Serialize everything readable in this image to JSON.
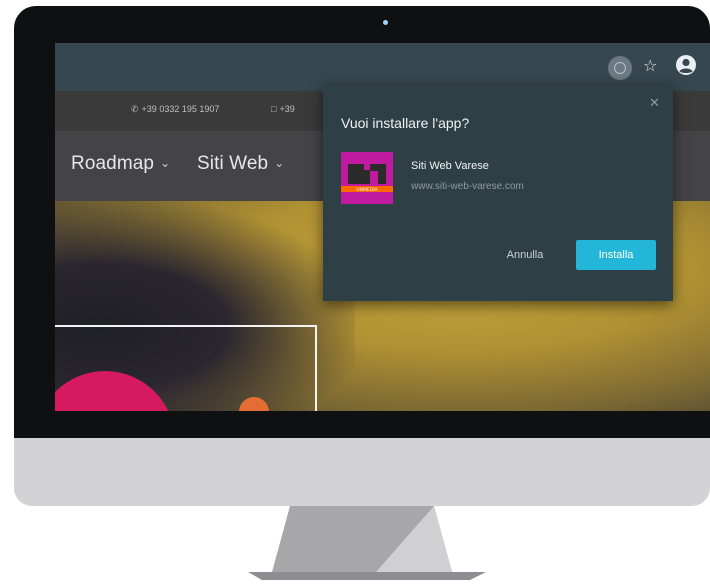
{
  "browser": {
    "icons": [
      "install-icon",
      "star-icon",
      "profile-icon"
    ]
  },
  "site": {
    "contacts": [
      {
        "icon": "phone-icon",
        "text": "+39 0332 195 1907"
      },
      {
        "icon": "phone-icon",
        "text": "+39"
      }
    ],
    "nav": [
      {
        "label": "Roadmap",
        "icon": "chevron-down-icon"
      },
      {
        "label": "Siti Web",
        "icon": "chevron-down-icon"
      }
    ]
  },
  "install_dialog": {
    "title": "Vuoi installare l'app?",
    "app_name": "Siti Web Varese",
    "app_url": "www.siti-web-varese.com",
    "cancel_label": "Annulla",
    "install_label": "Installa",
    "close_icon": "close-icon",
    "logo_text": "UNMEDIA"
  },
  "colors": {
    "toolbar": "#36474f",
    "dialog_bg": "#2f3f46",
    "install_button": "#23b6d8",
    "logo_magenta": "#c01ba0",
    "hero_gold": "#c7a93e",
    "hero_pink": "#d51a5f"
  }
}
